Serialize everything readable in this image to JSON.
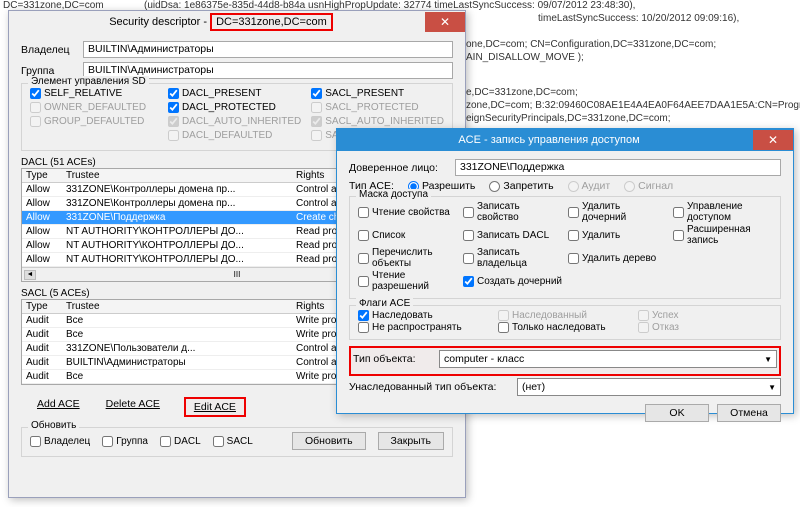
{
  "bg": {
    "l0": "DC=331zone,DC=com",
    "l1": "(uidDsa: 1e86375e-835d-44d8-b84a usnHighPropUpdate: 32774 timeLastSyncSuccess: 09/07/2012 23:48:30),",
    "l2": "timeLastSyncSuccess: 10/20/2012 09:09:16),",
    "l3": "one,DC=com; CN=Configuration,DC=331zone,DC=com;",
    "l4": "AIN_DISALLOW_MOVE );",
    "l5": "e,DC=331zone,DC=com;",
    "l6": "zone,DC=com; B:32:09460C08AE1E4A4EA0F64AEE7DAA1E5A:CN=Program",
    "l7": "eignSecurityPrincipals,DC=331zone,DC=com;"
  },
  "sd": {
    "title_prefix": "Security descriptor - ",
    "title_dn": "DC=331zone,DC=com",
    "owner_lbl": "Владелец",
    "group_lbl": "Группа",
    "owner": "BUILTIN\\Администраторы",
    "group": "BUILTIN\\Администраторы",
    "sdctrl_title": "Элемент управления SD",
    "cb": {
      "self_relative": "SELF_RELATIVE",
      "owner_def": "OWNER_DEFAULTED",
      "group_def": "GROUP_DEFAULTED",
      "dacl_present": "DACL_PRESENT",
      "dacl_protected": "DACL_PROTECTED",
      "dacl_auto": "DACL_AUTO_INHERITED",
      "dacl_def": "DACL_DEFAULTED",
      "sacl_present": "SACL_PRESENT",
      "sacl_protected": "SACL_PROTECTED",
      "sacl_auto": "SACL_AUTO_INHERITED",
      "sacl_def": "SACL_DEFAULTED"
    },
    "dacl_title": "DACL (51 ACEs)",
    "sacl_title": "SACL (5 ACEs)",
    "cols": {
      "type": "Type",
      "trustee": "Trustee",
      "rights": "Rights"
    },
    "dacl": [
      {
        "type": "Allow",
        "trustee": "331ZONE\\Контроллеры домена пр...",
        "rights": "Control access (Replica..."
      },
      {
        "type": "Allow",
        "trustee": "331ZONE\\Контроллеры домена пр...",
        "rights": "Control access (Replica..."
      },
      {
        "type": "Allow",
        "trustee": "331ZONE\\Поддержка",
        "rights": "Create child (computer"
      },
      {
        "type": "Allow",
        "trustee": "NT AUTHORITY\\КОНТРОЛЛЕРЫ ДО...",
        "rights": "Read property (tokenG..."
      },
      {
        "type": "Allow",
        "trustee": "NT AUTHORITY\\КОНТРОЛЛЕРЫ ДО...",
        "rights": "Read property (tokenG..."
      },
      {
        "type": "Allow",
        "trustee": "NT AUTHORITY\\КОНТРОЛЛЕРЫ ДО...",
        "rights": "Read property (tokenG..."
      }
    ],
    "sacl": [
      {
        "type": "Audit",
        "trustee": "Все",
        "rights": "Write property (gPLink)"
      },
      {
        "type": "Audit",
        "trustee": "Все",
        "rights": "Write property (gPOptions)"
      },
      {
        "type": "Audit",
        "trustee": "331ZONE\\Пользователи д...",
        "rights": "Control access"
      },
      {
        "type": "Audit",
        "trustee": "BUILTIN\\Администраторы",
        "rights": "Control access"
      },
      {
        "type": "Audit",
        "trustee": "Все",
        "rights": "Write property, Write DACL..."
      }
    ],
    "btns": {
      "add": "Add ACE",
      "del": "Delete ACE",
      "edit": "Edit ACE"
    },
    "refresh_title": "Обновить",
    "refresh": {
      "owner": "Владелец",
      "group": "Группа",
      "dacl": "DACL",
      "sacl": "SACL"
    },
    "update": "Обновить",
    "close": "Закрыть"
  },
  "ace": {
    "title": "ACE - запись управления доступом",
    "trustee_lbl": "Доверенное лицо:",
    "trustee": "331ZONE\\Поддержка",
    "type_lbl": "Тип ACE:",
    "types": {
      "allow": "Разрешить",
      "deny": "Запретить",
      "audit": "Аудит",
      "signal": "Сигнал"
    },
    "mask_title": "Маска доступа",
    "mask": {
      "read_prop": "Чтение свойства",
      "write_prop": "Записать свойство",
      "del_child": "Удалить дочерний",
      "ctl_access": "Управление доступом",
      "list": "Список",
      "write_dacl": "Записать DACL",
      "delete": "Удалить",
      "ext_write": "Расширенная запись",
      "enum": "Перечислить объекты",
      "write_owner": "Записать владельца",
      "del_tree": "Удалить дерево",
      "read_perm": "Чтение разрешений",
      "create_child": "Создать дочерний"
    },
    "flags_title": "Флаги ACE",
    "flags": {
      "inherit": "Наследовать",
      "inherited": "Наследованный",
      "success": "Успех",
      "noprop": "Не распространять",
      "onlyinh": "Только наследовать",
      "fail": "Отказ"
    },
    "obj_type_lbl": "Тип объекта:",
    "obj_type": "computer - класс",
    "inh_type_lbl": "Унаследованный тип объекта:",
    "inh_type": "(нет)",
    "ok": "OK",
    "cancel": "Отмена"
  }
}
